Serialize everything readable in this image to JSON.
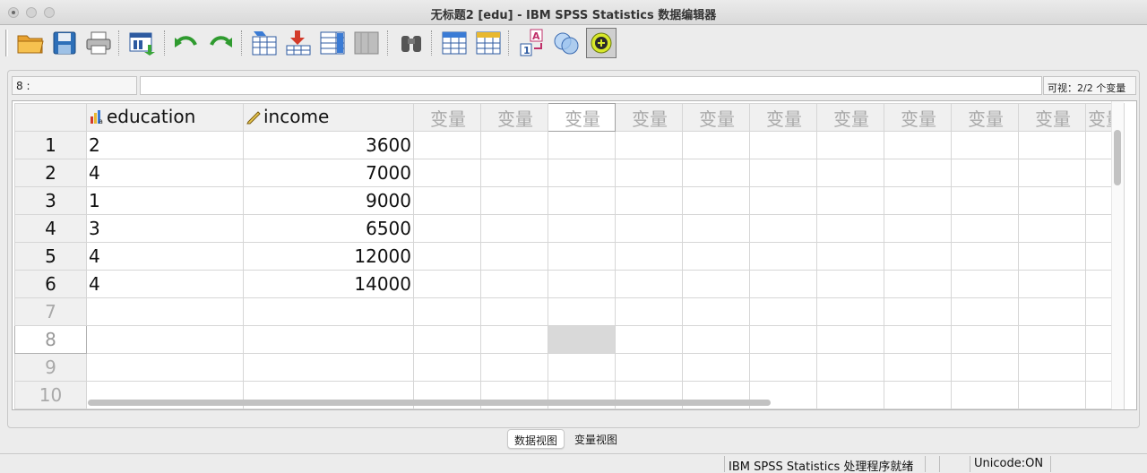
{
  "window": {
    "title": "无标题2 [edu] - IBM SPSS Statistics 数据编辑器"
  },
  "toolbar": {
    "buttons": [
      {
        "icon": "open-folder-icon"
      },
      {
        "icon": "save-icon"
      },
      {
        "icon": "print-icon"
      },
      {
        "icon": "recall-dialog-icon"
      },
      {
        "icon": "undo-icon"
      },
      {
        "icon": "redo-icon"
      },
      {
        "icon": "goto-case-icon"
      },
      {
        "icon": "goto-variable-icon"
      },
      {
        "icon": "variables-icon"
      },
      {
        "icon": "run-descriptives-icon"
      },
      {
        "icon": "find-icon"
      },
      {
        "icon": "insert-cases-icon"
      },
      {
        "icon": "insert-variable-icon"
      },
      {
        "icon": "value-labels-icon"
      },
      {
        "icon": "use-sets-icon"
      },
      {
        "icon": "spelling-icon"
      }
    ]
  },
  "cell_editor": {
    "cell_reference": "8 :",
    "value": "",
    "visible_count": "可视：2/2 个变量"
  },
  "grid": {
    "columns": [
      {
        "name": "education",
        "type": "ordinal"
      },
      {
        "name": "income",
        "type": "scale"
      }
    ],
    "empty_var_label": "变量",
    "empty_var_count": 11,
    "rows": [
      {
        "num": "1",
        "education": "2",
        "income": "3600"
      },
      {
        "num": "2",
        "education": "4",
        "income": "7000"
      },
      {
        "num": "3",
        "education": "1",
        "income": "9000"
      },
      {
        "num": "4",
        "education": "3",
        "income": "6500"
      },
      {
        "num": "5",
        "education": "4",
        "income": "12000"
      },
      {
        "num": "6",
        "education": "4",
        "income": "14000"
      },
      {
        "num": "7",
        "education": "",
        "income": ""
      },
      {
        "num": "8",
        "education": "",
        "income": ""
      },
      {
        "num": "9",
        "education": "",
        "income": ""
      },
      {
        "num": "10",
        "education": "",
        "income": ""
      }
    ],
    "current_row": "8",
    "selected_empty_column": 3
  },
  "tabs": [
    {
      "label": "数据视图",
      "active": true
    },
    {
      "label": "变量视图",
      "active": false
    }
  ],
  "statusbar": {
    "processor": "IBM SPSS Statistics 处理程序就绪",
    "unicode": "Unicode:ON"
  }
}
